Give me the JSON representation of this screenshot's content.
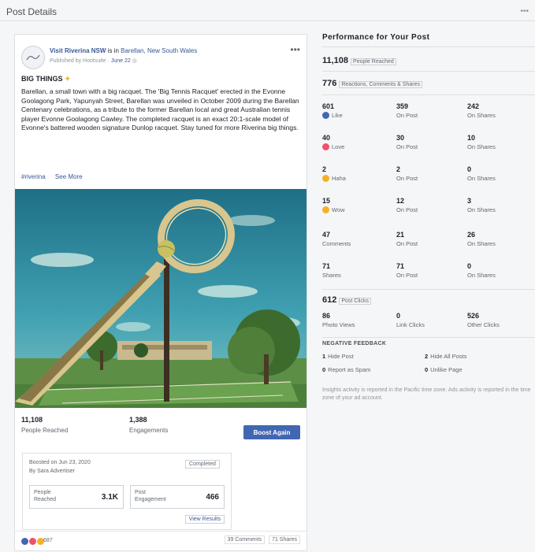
{
  "header": {
    "title": "Post Details"
  },
  "post": {
    "author": "Visit Riverina NSW",
    "is_in_text": "is in",
    "location": "Barellan, New South Wales",
    "published_by": "Published by Hootsuite",
    "date": "June 22",
    "title": "BIG THINGS",
    "body": "Barellan, a small town with a big racquet. The 'Big Tennis Racquet' erected in the Evonne Goolagong Park, Yapunyah Street, Barellan was unveiled in October 2009 during the Barellan Centenary celebrations, as a tribute to the former Barellan local and great Australian tennis player Evonne Goolagong Cawley. The completed racquet is an exact 20:1-scale model of Evonne's battered wooden signature Dunlop racquet. Stay tuned for more Riverina big things.",
    "hashtag": "#riverina",
    "see_more": "See More",
    "people_reached_value": "11,108",
    "people_reached_label": "People Reached",
    "engagements_value": "1,388",
    "engagements_label": "Engagements",
    "boost_button": "Boost Again",
    "boost": {
      "boosted_on": "Boosted on Jun 23, 2020",
      "by": "By Sara Advertiser",
      "status": "Completed",
      "people_reached_label": "People Reached",
      "people_reached_value": "3.1K",
      "post_engagement_label": "Post Engagement",
      "post_engagement_value": "466",
      "view_results": "View Results"
    },
    "reactions_count": "687",
    "comments": "39 Comments",
    "shares": "71 Shares"
  },
  "performance": {
    "title": "Performance for Your Post",
    "reached_value": "11,108",
    "reached_label": "People Reached",
    "engagement_value": "776",
    "engagement_label": "Reactions, Comments & Shares",
    "rows": [
      {
        "total": "601",
        "label": "Like",
        "on_post": "359",
        "on_post_label": "On Post",
        "on_shares": "242",
        "on_shares_label": "On Shares",
        "icon": "like-icon",
        "color": "#4267b2"
      },
      {
        "total": "40",
        "label": "Love",
        "on_post": "30",
        "on_post_label": "On Post",
        "on_shares": "10",
        "on_shares_label": "On Shares",
        "icon": "love-icon",
        "color": "#f25268"
      },
      {
        "total": "2",
        "label": "Haha",
        "on_post": "2",
        "on_post_label": "On Post",
        "on_shares": "0",
        "on_shares_label": "On Shares",
        "icon": "haha-icon",
        "color": "#f7b125"
      },
      {
        "total": "15",
        "label": "Wow",
        "on_post": "12",
        "on_post_label": "On Post",
        "on_shares": "3",
        "on_shares_label": "On Shares",
        "icon": "wow-icon",
        "color": "#f7b125"
      },
      {
        "total": "47",
        "label": "Comments",
        "on_post": "21",
        "on_post_label": "On Post",
        "on_shares": "26",
        "on_shares_label": "On Shares"
      },
      {
        "total": "71",
        "label": "Shares",
        "on_post": "71",
        "on_post_label": "On Post",
        "on_shares": "0",
        "on_shares_label": "On Shares"
      }
    ],
    "post_clicks_value": "612",
    "post_clicks_label": "Post Clicks",
    "clicks": [
      {
        "value": "86",
        "label": "Photo Views"
      },
      {
        "value": "0",
        "label": "Link Clicks"
      },
      {
        "value": "526",
        "label": "Other Clicks"
      }
    ],
    "negative_title": "NEGATIVE FEEDBACK",
    "negative": [
      {
        "value": "1",
        "label": "Hide Post"
      },
      {
        "value": "2",
        "label": "Hide All Posts"
      },
      {
        "value": "0",
        "label": "Report as Spam"
      },
      {
        "value": "0",
        "label": "Unlike Page"
      }
    ],
    "note": "Insights activity is reported in the Pacific time zone. Ads activity is reported in the time zone of your ad account."
  }
}
